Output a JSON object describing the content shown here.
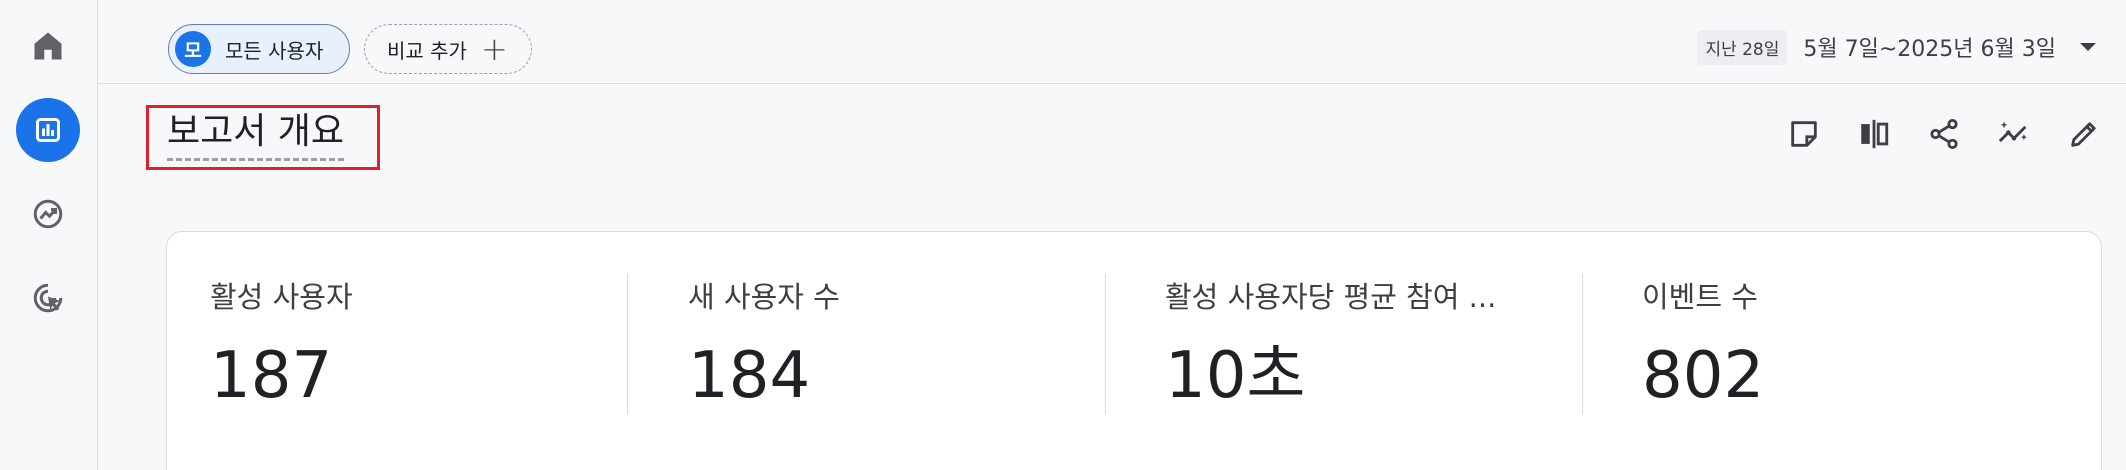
{
  "nav": {
    "items": [
      {
        "name": "home",
        "icon": "home-icon"
      },
      {
        "name": "reports",
        "icon": "bar-chart-icon",
        "active": true
      },
      {
        "name": "explore",
        "icon": "explore-icon"
      },
      {
        "name": "advertising",
        "icon": "target-cursor-icon"
      }
    ]
  },
  "topbar": {
    "segment_chip": {
      "avatar_letter": "모",
      "label": "모든 사용자"
    },
    "compare_chip": {
      "label": "비교 추가",
      "plus": "+"
    },
    "date_range": {
      "period": "지난 28일",
      "range": "5월 7일~2025년 6월 3일"
    }
  },
  "page": {
    "title": "보고서 개요"
  },
  "toolbar": {
    "icons": [
      "note-icon",
      "compare-columns-icon",
      "share-icon",
      "insights-icon",
      "edit-icon"
    ]
  },
  "metrics": [
    {
      "label": "활성 사용자",
      "value": "187"
    },
    {
      "label": "새 사용자 수",
      "value": "184"
    },
    {
      "label": "활성 사용자당 평균 참여 ...",
      "value": "10초"
    },
    {
      "label": "이벤트 수",
      "value": "802"
    }
  ],
  "colors": {
    "accent": "#1a73e8",
    "highlight": "#e0202c"
  }
}
